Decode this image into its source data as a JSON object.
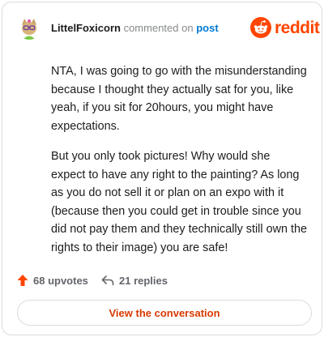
{
  "header": {
    "author": "LittelFoxicorn",
    "action": "commented on",
    "post_link": "post"
  },
  "brand": {
    "name": "reddit",
    "color": "#ff4500"
  },
  "comment": {
    "paragraphs": [
      "NTA, I was going to go with the misunderstanding because I thought they actually sat for you, like yeah, if you sit for 20hours, you might have expectations.",
      "But you only took pictures! Why would she expect to have any right to the painting? As long as you do not sell it or plan on an expo with it (because then you could get in trouble since you did not pay them and they technically still own the rights to their image) you are safe!"
    ]
  },
  "footer": {
    "upvotes_label": "68 upvotes",
    "replies_label": "21 replies"
  },
  "cta": {
    "label": "View the conversation"
  },
  "colors": {
    "accent": "#ff4500",
    "link": "#0079d3",
    "cta_text": "#d93900",
    "muted": "#62656a"
  }
}
